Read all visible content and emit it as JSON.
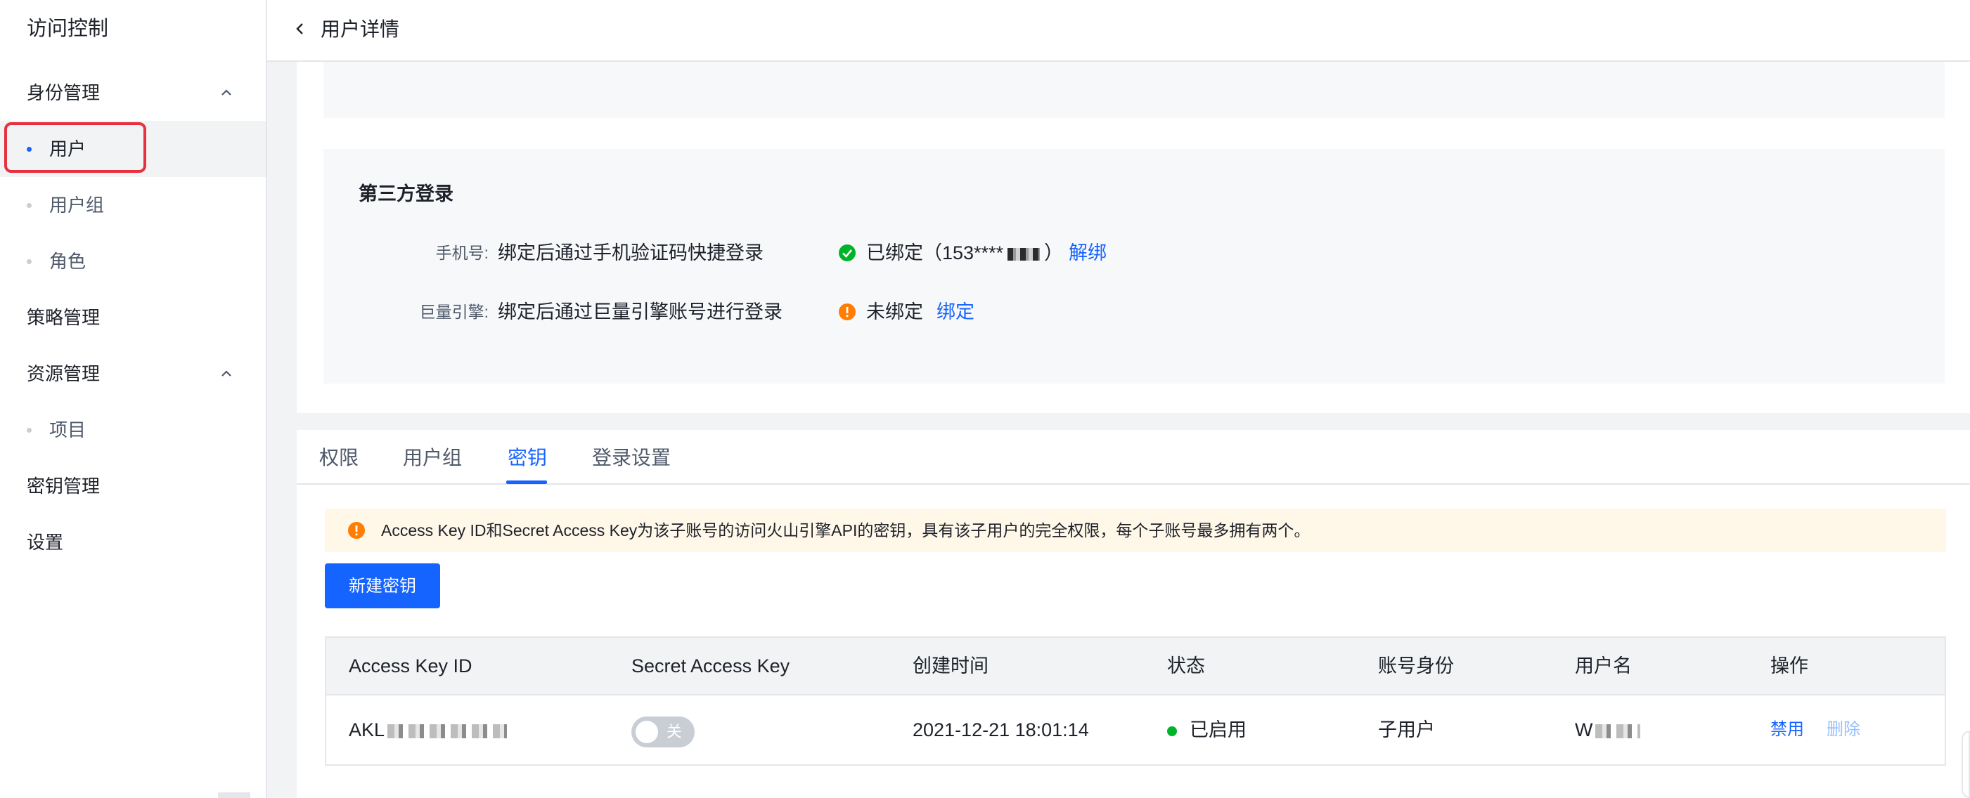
{
  "sidebar": {
    "title": "访问控制",
    "items": [
      {
        "label": "身份管理",
        "expanded": true
      },
      {
        "label": "用户",
        "active": true
      },
      {
        "label": "用户组"
      },
      {
        "label": "角色"
      },
      {
        "label": "策略管理"
      },
      {
        "label": "资源管理",
        "expanded": true
      },
      {
        "label": "项目"
      },
      {
        "label": "密钥管理"
      },
      {
        "label": "设置"
      }
    ]
  },
  "header": {
    "title": "用户详情",
    "back_icon": "chevron-left-icon"
  },
  "third_party_login": {
    "title": "第三方登录",
    "rows": [
      {
        "label": "手机号:",
        "description": "绑定后通过手机验证码快捷登录",
        "status": "已绑定（153****",
        "status_suffix": "）",
        "status_icon": "check-circle-icon",
        "status_color": "#00b42a",
        "action": "解绑"
      },
      {
        "label": "巨量引擎:",
        "description": "绑定后通过巨量引擎账号进行登录",
        "status": "未绑定",
        "status_icon": "warning-circle-icon",
        "status_color": "#ff7d00",
        "action": "绑定"
      }
    ]
  },
  "tabs": [
    {
      "label": "权限"
    },
    {
      "label": "用户组"
    },
    {
      "label": "密钥",
      "active": true
    },
    {
      "label": "登录设置"
    }
  ],
  "alert": {
    "text": "Access Key ID和Secret Access Key为该子账号的访问火山引擎API的密钥，具有该子用户的完全权限，每个子账号最多拥有两个。",
    "color": "#ff7d00"
  },
  "create_button": "新建密钥",
  "table": {
    "columns": [
      "Access Key ID",
      "Secret Access Key",
      "创建时间",
      "状态",
      "账号身份",
      "用户名",
      "操作"
    ],
    "rows": [
      {
        "access_key_id": "AKL",
        "secret_toggle": "关",
        "created_at": "2021-12-21 18:01:14",
        "status": "已启用",
        "identity": "子用户",
        "username": "W",
        "actions": [
          "禁用",
          "删除"
        ]
      }
    ]
  },
  "colors": {
    "accent": "#1664ff",
    "success": "#00b42a",
    "warning": "#ff7d00",
    "highlight": "#e8313f"
  }
}
